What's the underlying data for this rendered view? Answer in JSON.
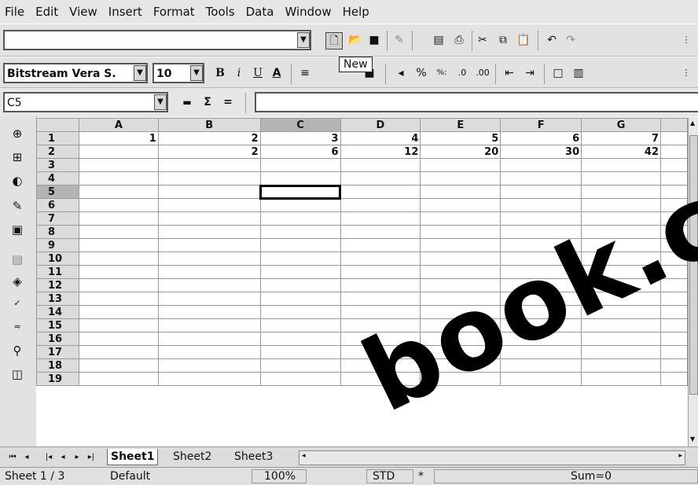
{
  "menu": [
    "File",
    "Edit",
    "View",
    "Insert",
    "Format",
    "Tools",
    "Data",
    "Window",
    "Help"
  ],
  "toolbar": {
    "url_value": "",
    "tooltip": "New",
    "icons": [
      "new-icon",
      "open-icon",
      "save-icon",
      "edit-file-icon",
      "export-pdf-icon",
      "print-icon",
      "cut-icon",
      "copy-icon",
      "paste-icon",
      "undo-icon",
      "redo-icon"
    ]
  },
  "format": {
    "font": "Bitstream Vera S.",
    "size": "10",
    "bold": "B",
    "italic": "i",
    "underline": "U"
  },
  "formula": {
    "cell_ref": "C5",
    "sum": "Σ",
    "equals": "=",
    "value": ""
  },
  "columns": [
    "A",
    "B",
    "C",
    "D",
    "E",
    "F",
    "G"
  ],
  "rows": [
    {
      "n": "1",
      "cells": [
        "1",
        "2",
        "3",
        "4",
        "5",
        "6",
        "7"
      ]
    },
    {
      "n": "2",
      "cells": [
        "",
        "2",
        "6",
        "12",
        "20",
        "30",
        "42"
      ]
    },
    {
      "n": "3",
      "cells": [
        "",
        "",
        "",
        "",
        "",
        "",
        ""
      ]
    },
    {
      "n": "4",
      "cells": [
        "",
        "",
        "",
        "",
        "",
        "",
        ""
      ]
    },
    {
      "n": "5",
      "cells": [
        "",
        "",
        "",
        "",
        "",
        "",
        ""
      ]
    },
    {
      "n": "6",
      "cells": [
        "",
        "",
        "",
        "",
        "",
        "",
        ""
      ]
    },
    {
      "n": "7",
      "cells": [
        "",
        "",
        "",
        "",
        "",
        "",
        ""
      ]
    },
    {
      "n": "8",
      "cells": [
        "",
        "",
        "",
        "",
        "",
        "",
        ""
      ]
    },
    {
      "n": "9",
      "cells": [
        "",
        "",
        "",
        "",
        "",
        "",
        ""
      ]
    },
    {
      "n": "10",
      "cells": [
        "",
        "",
        "",
        "",
        "",
        "",
        ""
      ]
    },
    {
      "n": "11",
      "cells": [
        "",
        "",
        "",
        "",
        "",
        "",
        ""
      ]
    },
    {
      "n": "12",
      "cells": [
        "",
        "",
        "",
        "",
        "",
        "",
        ""
      ]
    },
    {
      "n": "13",
      "cells": [
        "",
        "",
        "",
        "",
        "",
        "",
        ""
      ]
    },
    {
      "n": "14",
      "cells": [
        "",
        "",
        "",
        "",
        "",
        "",
        ""
      ]
    },
    {
      "n": "15",
      "cells": [
        "",
        "",
        "",
        "",
        "",
        "",
        ""
      ]
    },
    {
      "n": "16",
      "cells": [
        "",
        "",
        "",
        "",
        "",
        "",
        ""
      ]
    },
    {
      "n": "17",
      "cells": [
        "",
        "",
        "",
        "",
        "",
        "",
        ""
      ]
    },
    {
      "n": "18",
      "cells": [
        "",
        "",
        "",
        "",
        "",
        "",
        ""
      ]
    },
    {
      "n": "19",
      "cells": [
        "",
        "",
        "",
        "",
        "",
        "",
        ""
      ]
    }
  ],
  "selection": {
    "col": "C",
    "row": "5"
  },
  "tabs": [
    "Sheet1",
    "Sheet2",
    "Sheet3"
  ],
  "status": {
    "sheet": "Sheet 1 / 3",
    "style": "Default",
    "zoom": "100%",
    "mode": "STD",
    "modified": "*",
    "sum": "Sum=0"
  },
  "watermark": "book.com"
}
